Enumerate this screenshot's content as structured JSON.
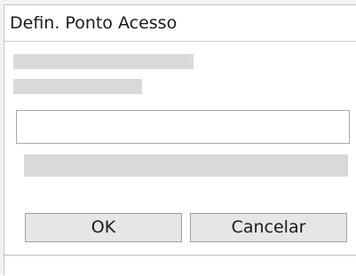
{
  "dialog": {
    "title": "Defin. Ponto Acesso",
    "ok_label": "OK",
    "cancel_label": "Cancelar"
  }
}
